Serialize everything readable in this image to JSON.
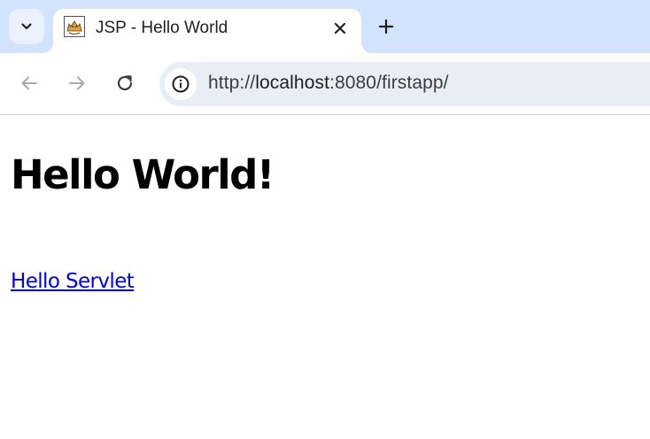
{
  "browser": {
    "tab": {
      "title": "JSP - Hello World",
      "favicon": "tomcat-icon"
    },
    "icons": {
      "tab_search": "chevron-down-icon",
      "close": "close-icon",
      "new_tab": "plus-icon",
      "back": "arrow-left-icon",
      "forward": "arrow-right-icon",
      "reload": "reload-icon",
      "site_info": "info-icon"
    },
    "url": {
      "scheme": "http://",
      "host": "localhost",
      "rest": ":8080/firstapp/"
    },
    "colors": {
      "tabstrip": "#d3e3fd",
      "omnibox": "#e9eef6",
      "link": "#0000ee"
    }
  },
  "page": {
    "heading": "Hello World!",
    "link_text": "Hello Servlet"
  }
}
